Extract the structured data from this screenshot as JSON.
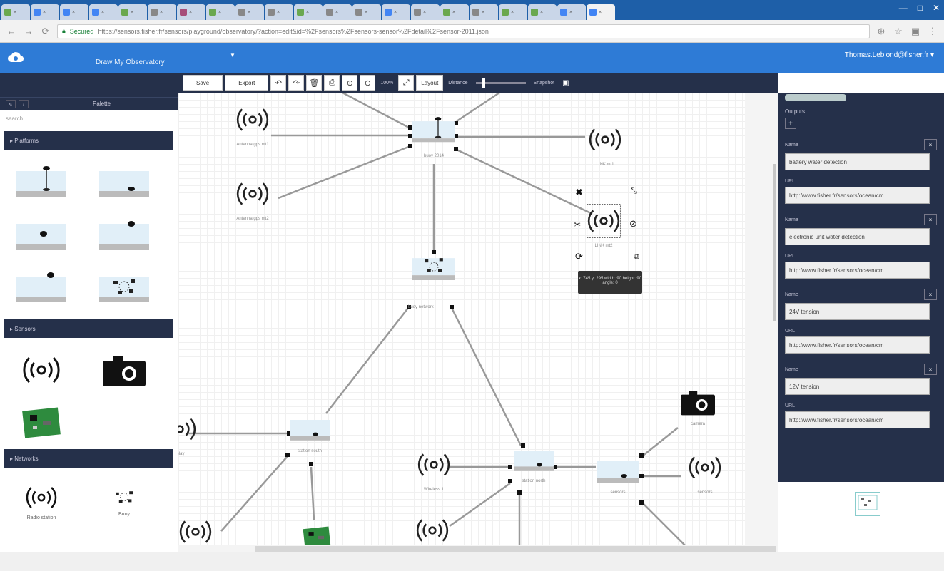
{
  "browser": {
    "tabs": [
      {
        "label": "×",
        "color": "#6aa84f"
      },
      {
        "label": "×",
        "color": "#4285f4"
      },
      {
        "label": "×",
        "color": "#4285f4"
      },
      {
        "label": "×",
        "color": "#4285f4"
      },
      {
        "label": "×",
        "color": "#6aa84f"
      },
      {
        "label": "×",
        "color": "#888888"
      },
      {
        "label": "×",
        "color": "#a64d79"
      },
      {
        "label": "×",
        "color": "#6aa84f"
      },
      {
        "label": "×",
        "color": "#888888"
      },
      {
        "label": "×",
        "color": "#888888"
      },
      {
        "label": "×",
        "color": "#6aa84f"
      },
      {
        "label": "×",
        "color": "#888888"
      },
      {
        "label": "×",
        "color": "#888888"
      },
      {
        "label": "×",
        "color": "#4285f4"
      },
      {
        "label": "×",
        "color": "#888888"
      },
      {
        "label": "×",
        "color": "#6aa84f"
      },
      {
        "label": "×",
        "color": "#888888"
      },
      {
        "label": "×",
        "color": "#6aa84f"
      },
      {
        "label": "×",
        "color": "#6aa84f"
      },
      {
        "label": "×",
        "color": "#4285f4"
      }
    ],
    "active_tab_label": "×",
    "secure_label": "Secured",
    "url": "https://sensors.fisher.fr/sensors/playground/observatory/?action=edit&id=%2Fsensors%2Fsensors-sensor%2Fdetail%2Fsensor-2011.json",
    "window_controls": [
      "—",
      "□",
      "✕"
    ]
  },
  "app": {
    "title": "Draw My Observatory",
    "user": "Thomas.Leblond@fisher.fr ▾"
  },
  "palette": {
    "title": "Palette",
    "search_placeholder": "search",
    "sections": [
      {
        "title": "▸ Platforms"
      },
      {
        "title": "▸ Sensors"
      },
      {
        "title": "▸ Networks"
      }
    ],
    "network_labels": [
      "Radio station",
      "Buoy"
    ]
  },
  "toolbar": {
    "save_label": "Save",
    "export_label": "Export",
    "zoom_label": "100%",
    "layout_label": "Layout",
    "distance_label": "Distance",
    "snapshot_label": "Snapshot"
  },
  "canvas": {
    "node_labels": {
      "n1": "Antenna gps mt1",
      "n2": "Antenna gps mt2",
      "n3": "buoy 2014",
      "n4": "LINK mt1",
      "n5": "LINK mt2",
      "n6": "buoy network",
      "n7": "relay",
      "n8": "station south",
      "n9": "Wireless 1",
      "n10": "station north",
      "n11": "sensors",
      "n12": "camera",
      "n13": "sensors"
    },
    "tooltip": "x: 745 y: 295 width: 90 height: 90 angle: 0"
  },
  "properties": {
    "outputs_label": "Outputs",
    "outputs": [
      {
        "name_label": "Name",
        "name": "battery water detection",
        "url_label": "URL",
        "url": "http://www.fisher.fr/sensors/ocean/cm"
      },
      {
        "name_label": "Name",
        "name": "electronic unit water detection",
        "url_label": "URL",
        "url": "http://www.fisher.fr/sensors/ocean/cm"
      },
      {
        "name_label": "Name",
        "name": "24V tension",
        "url_label": "URL",
        "url": "http://www.fisher.fr/sensors/ocean/cm"
      },
      {
        "name_label": "Name",
        "name": "12V tension",
        "url_label": "URL",
        "url": "http://www.fisher.fr/sensors/ocean/cm"
      }
    ]
  }
}
